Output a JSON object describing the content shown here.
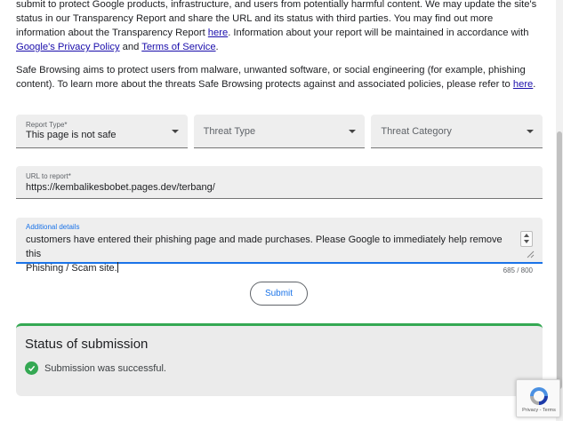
{
  "intro": {
    "p1_part1": "submit to protect Google products, infrastructure, and users from potentially harmful content. We may update the site's status in our Transparency Report and share the URL and its status with third parties. You may find out more information about the Transparency Report ",
    "p1_link_here": "here",
    "p1_part2": ". Information about your report will be maintained in accordance with ",
    "p1_link_privacy": "Google's Privacy Policy",
    "p1_and": " and ",
    "p1_link_terms": "Terms of Service",
    "p1_end": ".",
    "p2_text": "Safe Browsing aims to protect users from malware, unwanted software, or social engineering (for example, phishing content). To learn more about the threats Safe Browsing protects against and associated policies, please refer to ",
    "p2_link_here": "here",
    "p2_end": "."
  },
  "form": {
    "report_type": {
      "label": "Report Type*",
      "value": "This page is not safe"
    },
    "threat_type": {
      "placeholder": "Threat Type"
    },
    "threat_category": {
      "placeholder": "Threat Category"
    },
    "url": {
      "label": "URL to report*",
      "value": "https://kembalikesbobet.pages.dev/terbang/"
    },
    "details": {
      "label": "Additional details",
      "line1": "customers have entered their phishing page and made purchases. Please Google to immediately help remove this",
      "line2": "Phishing / Scam site."
    },
    "counter": "685 / 800",
    "submit_label": "Submit"
  },
  "status": {
    "title": "Status of submission",
    "message": "Submission was successful."
  },
  "recaptcha": {
    "links": "Privacy - Terms"
  },
  "colors": {
    "accent": "#1a73e8",
    "success": "#34a853",
    "link": "#1a0dab"
  },
  "icons": [
    "dropdown-caret-icon",
    "check-circle-icon",
    "spinner-icon",
    "resize-handle-icon",
    "recaptcha-logo-icon"
  ]
}
